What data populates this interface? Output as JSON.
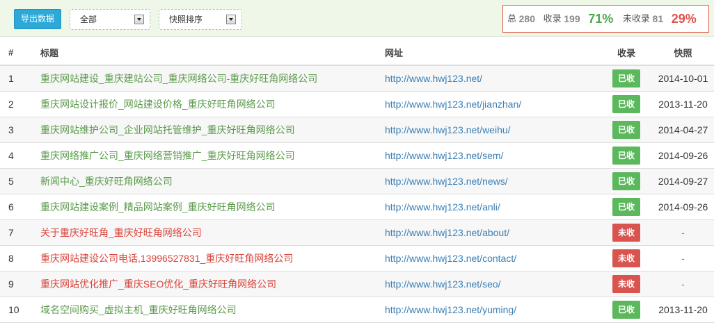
{
  "toolbar": {
    "export_label": "导出数据",
    "filter_value": "全部",
    "sort_value": "快照排序"
  },
  "stats": {
    "total_label": "总",
    "total": "280",
    "indexed_label": "收录",
    "indexed": "199",
    "indexed_pct": "71%",
    "not_indexed_label": "未收录",
    "not_indexed": "81",
    "not_indexed_pct": "29%"
  },
  "table": {
    "headers": {
      "num": "#",
      "title": "标题",
      "url": "网址",
      "status": "收录",
      "snapshot": "快照"
    },
    "rows": [
      {
        "num": "1",
        "title": "重庆网站建设_重庆建站公司_重庆网络公司-重庆好旺角网络公司",
        "url": "http://www.hwj123.net/",
        "status": "已收",
        "indexed": true,
        "snapshot": "2014-10-01"
      },
      {
        "num": "2",
        "title": "重庆网站设计报价_网站建设价格_重庆好旺角网络公司",
        "url": "http://www.hwj123.net/jianzhan/",
        "status": "已收",
        "indexed": true,
        "snapshot": "2013-11-20"
      },
      {
        "num": "3",
        "title": "重庆网站维护公司_企业网站托管维护_重庆好旺角网络公司",
        "url": "http://www.hwj123.net/weihu/",
        "status": "已收",
        "indexed": true,
        "snapshot": "2014-04-27"
      },
      {
        "num": "4",
        "title": "重庆网络推广公司_重庆网络营销推广_重庆好旺角网络公司",
        "url": "http://www.hwj123.net/sem/",
        "status": "已收",
        "indexed": true,
        "snapshot": "2014-09-26"
      },
      {
        "num": "5",
        "title": "新闻中心_重庆好旺角网络公司",
        "url": "http://www.hwj123.net/news/",
        "status": "已收",
        "indexed": true,
        "snapshot": "2014-09-27"
      },
      {
        "num": "6",
        "title": "重庆网站建设案例_精品网站案例_重庆好旺角网络公司",
        "url": "http://www.hwj123.net/anli/",
        "status": "已收",
        "indexed": true,
        "snapshot": "2014-09-26"
      },
      {
        "num": "7",
        "title": "关于重庆好旺角_重庆好旺角网络公司",
        "url": "http://www.hwj123.net/about/",
        "status": "未收",
        "indexed": false,
        "snapshot": "-"
      },
      {
        "num": "8",
        "title": "重庆网站建设公司电话,13996527831_重庆好旺角网络公司",
        "url": "http://www.hwj123.net/contact/",
        "status": "未收",
        "indexed": false,
        "snapshot": "-"
      },
      {
        "num": "9",
        "title": "重庆网站优化推广_重庆SEO优化_重庆好旺角网络公司",
        "url": "http://www.hwj123.net/seo/",
        "status": "未收",
        "indexed": false,
        "snapshot": "-"
      },
      {
        "num": "10",
        "title": "域名空间购买_虚拟主机_重庆好旺角网络公司",
        "url": "http://www.hwj123.net/yuming/",
        "status": "已收",
        "indexed": true,
        "snapshot": "2013-11-20"
      }
    ]
  },
  "colors": {
    "indexed": "#5cb85c",
    "not_indexed": "#d9534f",
    "accent": "#2ca9d9"
  }
}
